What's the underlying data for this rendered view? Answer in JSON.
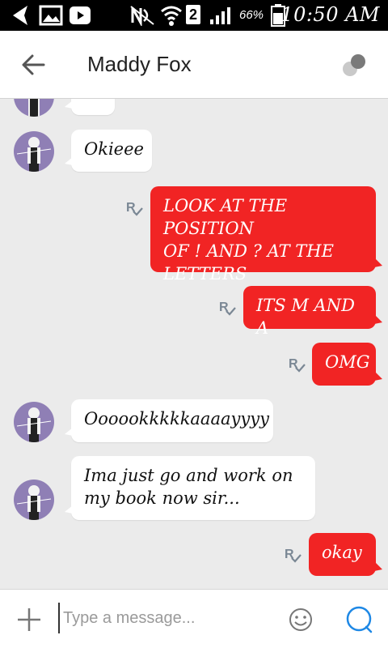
{
  "status_bar": {
    "sim_slot": "2",
    "battery_percent": "66%",
    "time": "10:50 AM"
  },
  "header": {
    "contact_name": "Maddy Fox"
  },
  "messages": [
    {
      "direction": "incoming",
      "text": "..."
    },
    {
      "direction": "incoming",
      "text": "Okieee"
    },
    {
      "direction": "outgoing",
      "lines": [
        "LOOK AT THE POSITION",
        "OF ! AND ? AT THE",
        "LETTERS"
      ],
      "read": true
    },
    {
      "direction": "outgoing",
      "text": "ITS M AND A",
      "read": true
    },
    {
      "direction": "outgoing",
      "text": "OMG",
      "read": true
    },
    {
      "direction": "incoming",
      "text": "Oooookkkkkaaaayyyy"
    },
    {
      "direction": "incoming",
      "lines": [
        "Ima just go and work on",
        "my book now sir..."
      ]
    },
    {
      "direction": "outgoing",
      "text": "okay",
      "read": true
    }
  ],
  "composer": {
    "placeholder": "Type a message..."
  },
  "colors": {
    "outgoing_bubble": "#f12424",
    "incoming_bubble": "#ffffff",
    "chat_background": "#ebebeb",
    "send_icon": "#1e88e5"
  }
}
